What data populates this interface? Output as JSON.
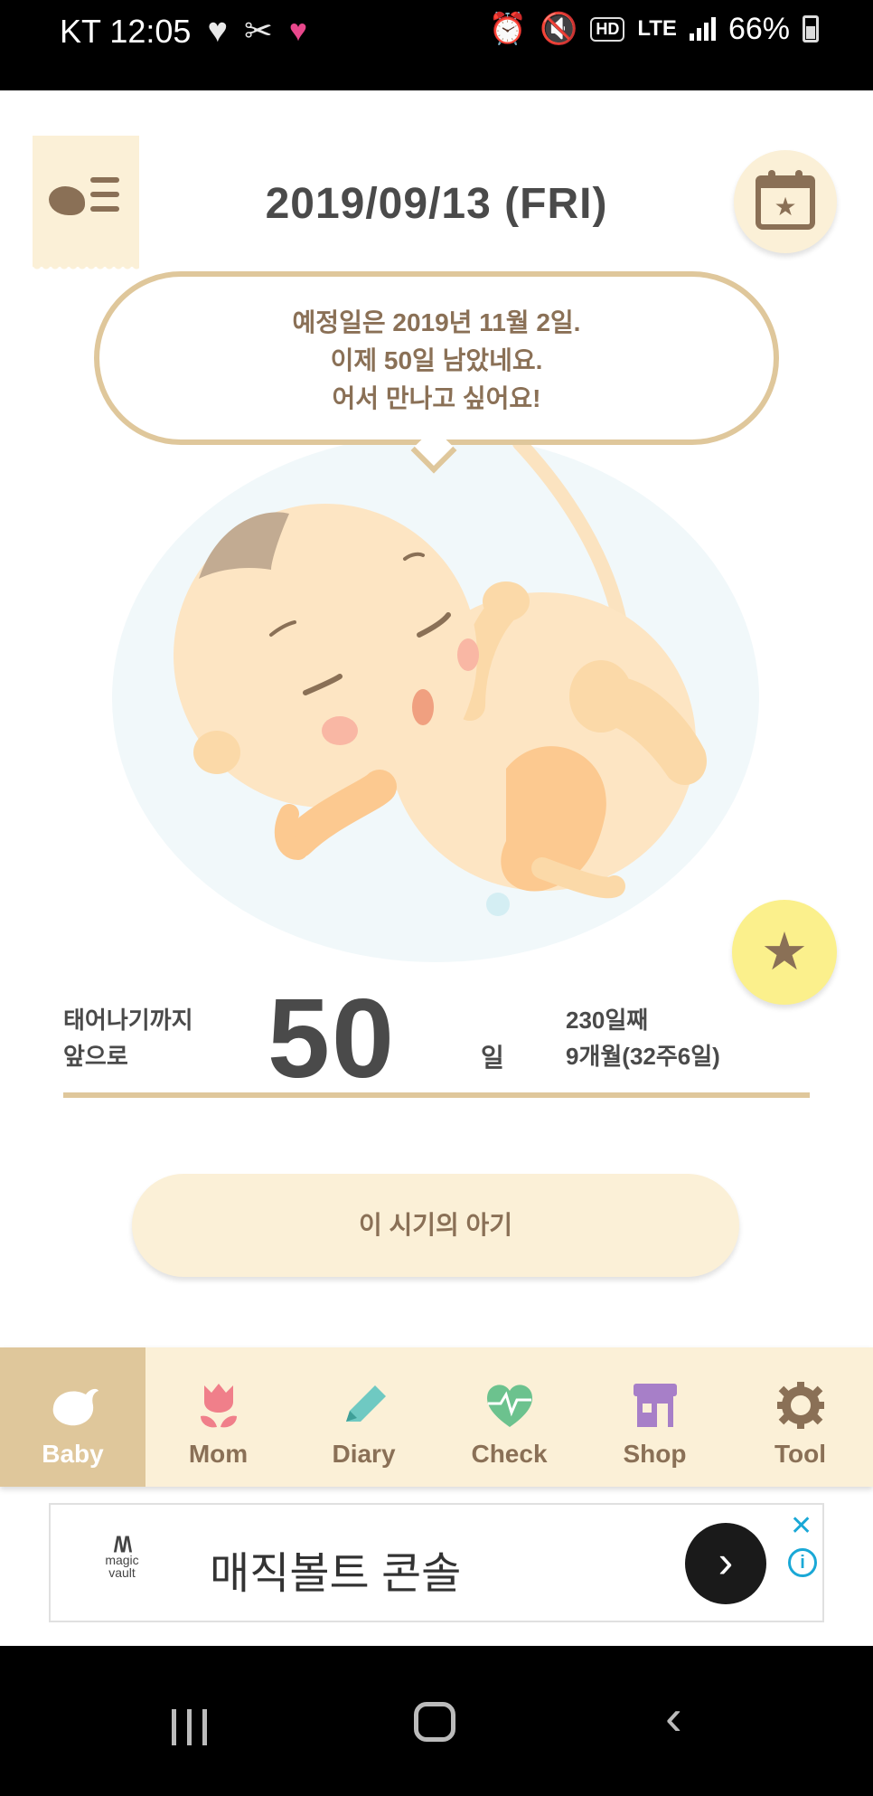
{
  "status_bar": {
    "carrier_time": "KT 12:05",
    "network": "LTE",
    "battery": "66%"
  },
  "header": {
    "date": "2019/09/13 (FRI)"
  },
  "bubble": {
    "line1": "예정일은 2019년 11월 2일.",
    "line2": "이제 50일 남았네요.",
    "line3": "어서 만나고 싶어요!"
  },
  "countdown": {
    "left_line1": "태어나기까지",
    "left_line2": "앞으로",
    "days": "50",
    "unit": "일",
    "right_line1": "230일째",
    "right_line2": "9개월(32주6일)"
  },
  "baby_button_label": "이 시기의 아기",
  "nav": {
    "tabs": [
      {
        "label": "Baby",
        "icon": "bird-icon",
        "color": "#ffffff",
        "active": true
      },
      {
        "label": "Mom",
        "icon": "tulip-icon",
        "color": "#8a7056",
        "icon_color": "#f07f8a"
      },
      {
        "label": "Diary",
        "icon": "pencil-icon",
        "color": "#8a7056",
        "icon_color": "#6fc9c2"
      },
      {
        "label": "Check",
        "icon": "heartbeat-icon",
        "color": "#8a7056",
        "icon_color": "#6cc28e"
      },
      {
        "label": "Shop",
        "icon": "shop-icon",
        "color": "#8a7056",
        "icon_color": "#a77fc8"
      },
      {
        "label": "Tool",
        "icon": "gear-icon",
        "color": "#8a7056",
        "icon_color": "#8a7056"
      }
    ]
  },
  "ad": {
    "brand": "magic vault",
    "title": "매직볼트 콘솔"
  },
  "colors": {
    "accent": "#dfc79b",
    "brown": "#8a7056",
    "cream": "#fbf0d7"
  }
}
